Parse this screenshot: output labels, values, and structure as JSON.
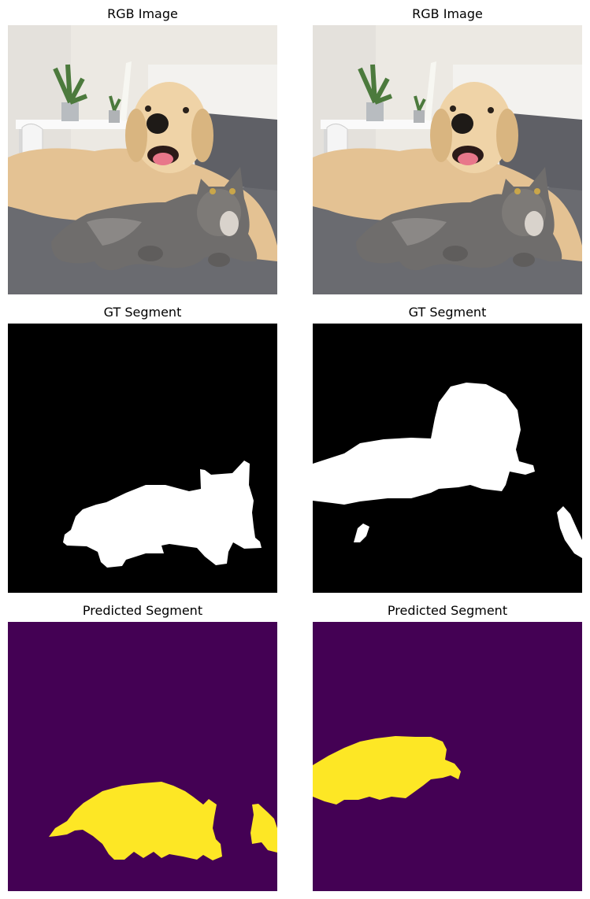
{
  "panels": [
    {
      "title": "RGB Image"
    },
    {
      "title": "RGB Image"
    },
    {
      "title": "GT Segment"
    },
    {
      "title": "GT Segment"
    },
    {
      "title": "Predicted Segment"
    },
    {
      "title": "Predicted Segment"
    }
  ],
  "colors": {
    "mask_background": "#000000",
    "mask_foreground": "#ffffff",
    "pred_background": "#440154",
    "pred_foreground": "#fde725"
  },
  "image_content": {
    "subject": "golden retriever dog lying behind a grey tabby cat on a bed",
    "gt_left_mask_object": "cat",
    "gt_right_mask_object": "dog"
  }
}
